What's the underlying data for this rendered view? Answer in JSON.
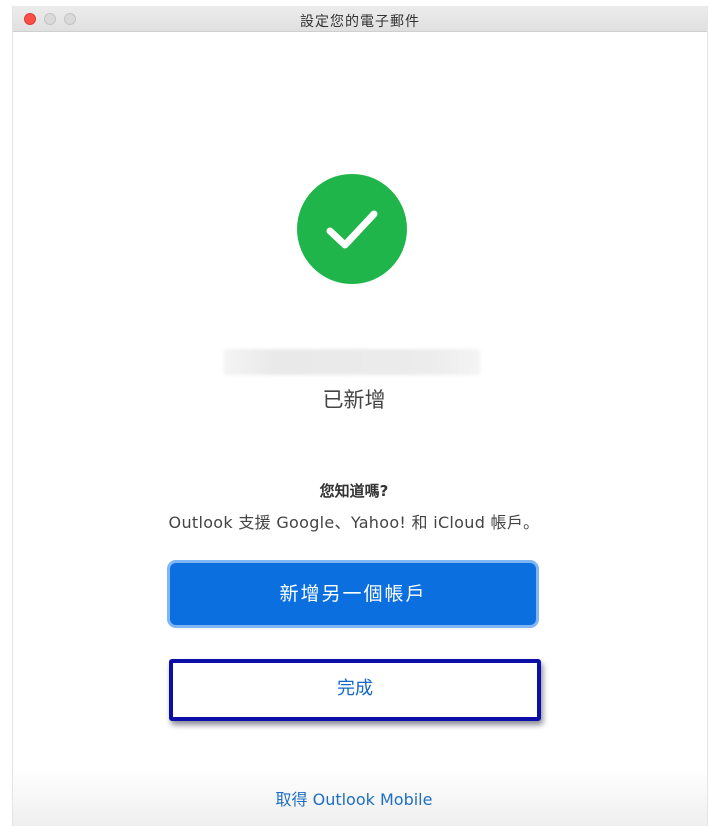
{
  "window": {
    "title": "設定您的電子郵件"
  },
  "status": {
    "added_label": "已新增"
  },
  "tip": {
    "title": "您知道嗎?",
    "body": "Outlook 支援 Google、Yahoo! 和 iCloud 帳戶。"
  },
  "buttons": {
    "add_another": "新增另一個帳戶",
    "done": "完成"
  },
  "footer": {
    "get_mobile": "取得 Outlook Mobile"
  },
  "colors": {
    "success_green": "#20b54a",
    "primary_blue": "#0b6fe0",
    "link_blue": "#1e6fc2",
    "highlight_border": "#0c0ea8"
  },
  "icons": {
    "success": "checkmark-icon"
  }
}
